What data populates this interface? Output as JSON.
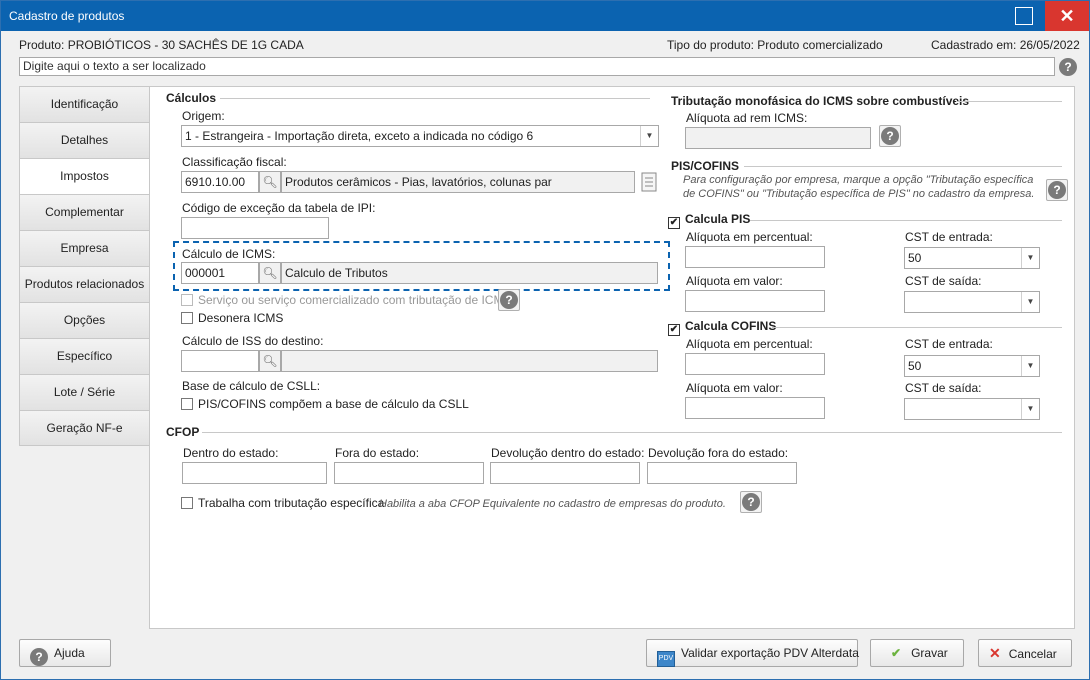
{
  "window": {
    "title": "Cadastro de produtos"
  },
  "info": {
    "produto": "Produto: PROBIÓTICOS - 30 SACHÊS DE 1G CADA",
    "tipo": "Tipo do produto: Produto comercializado",
    "cadastrado": "Cadastrado em: 26/05/2022"
  },
  "search": {
    "placeholder": "Digite aqui o texto a ser localizado"
  },
  "tabs": [
    "Identificação",
    "Detalhes",
    "Impostos",
    "Complementar",
    "Empresa",
    "Produtos relacionados",
    "Opções",
    "Específico",
    "Lote / Série",
    "Geração NF-e"
  ],
  "calculos": {
    "title": "Cálculos",
    "origem_label": "Origem:",
    "origem_value": "1 - Estrangeira - Importação direta, exceto a indicada no código 6",
    "classif_label": "Classificação fiscal:",
    "classif_code": "6910.10.00",
    "classif_desc": "Produtos cerâmicos - Pias, lavatórios, colunas par",
    "ipi_label": "Código de exceção da tabela de IPI:",
    "icms_label": "Cálculo de ICMS:",
    "icms_code": "000001",
    "icms_desc": "Calculo de Tributos",
    "servico_label": "Serviço ou serviço comercializado com tributação de ICMS",
    "desonera_label": "Desonera ICMS",
    "iss_label": "Cálculo de ISS do destino:",
    "csll_label": "Base de cálculo de CSLL:",
    "csll_check": "PIS/COFINS compõem a base de cálculo da CSLL"
  },
  "monofasica": {
    "title": "Tributação monofásica do ICMS sobre combustíveis",
    "aliquota_label": "Alíquota ad rem ICMS:"
  },
  "piscofins": {
    "title": "PIS/COFINS",
    "note": "Para configuração por empresa, marque a opção \"Tributação específica de COFINS\" ou \"Tributação específica de PIS\" no cadastro da empresa.",
    "pis": {
      "check_label": "Calcula PIS",
      "aliq_perc": "Alíquota em percentual:",
      "aliq_valor": "Alíquota em valor:",
      "cst_entrada": "CST de entrada:",
      "cst_entrada_value": "50",
      "cst_saida": "CST de saída:"
    },
    "cofins": {
      "check_label": "Calcula COFINS",
      "aliq_perc": "Alíquota em percentual:",
      "aliq_valor": "Alíquota em valor:",
      "cst_entrada": "CST de entrada:",
      "cst_entrada_value": "50",
      "cst_saida": "CST de saída:"
    }
  },
  "cfop": {
    "title": "CFOP",
    "dentro": "Dentro do estado:",
    "fora": "Fora do estado:",
    "dev_dentro": "Devolução dentro do estado:",
    "dev_fora": "Devolução fora do estado:",
    "trabalha": "Trabalha com tributação específica",
    "hint": "Habilita a aba CFOP Equivalente no cadastro de empresas do produto."
  },
  "footer": {
    "ajuda": "Ajuda",
    "validar": "Validar exportação PDV Alterdata",
    "gravar": "Gravar",
    "cancelar": "Cancelar"
  },
  "colors": {
    "titlebar": "#0b63b0",
    "close": "#d9362f",
    "highlight": "#0b63b0"
  }
}
